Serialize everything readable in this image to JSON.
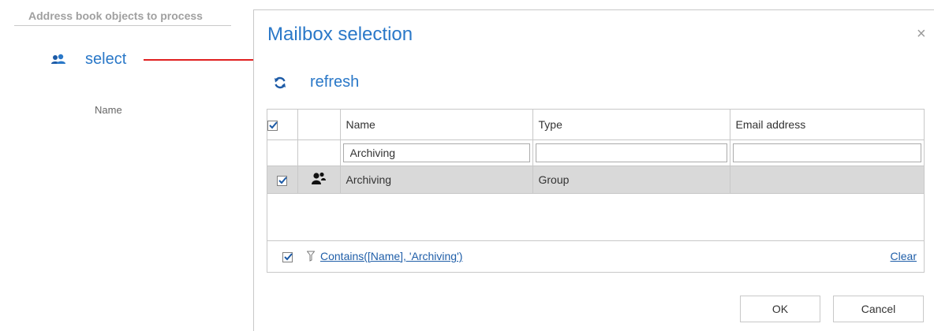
{
  "background": {
    "section_title": "Address book objects to process",
    "select_label": "select",
    "name_label": "Name"
  },
  "dialog": {
    "title": "Mailbox selection",
    "close_symbol": "×",
    "refresh_label": "refresh",
    "columns": [
      "Name",
      "Type",
      "Email address"
    ],
    "filters": {
      "name": "Archiving",
      "type": "",
      "email": ""
    },
    "rows": [
      {
        "checked": true,
        "icon": "group-icon",
        "name": "Archiving",
        "type": "Group",
        "email": ""
      }
    ],
    "footer": {
      "filter_expression": "Contains([Name], 'Archiving')",
      "clear_label": "Clear"
    },
    "ok_label": "OK",
    "cancel_label": "Cancel"
  },
  "colors": {
    "accent": "#2a78c8",
    "link": "#1f5ea8",
    "selected_row": "#d9d9d9",
    "arrow": "#e02020"
  }
}
